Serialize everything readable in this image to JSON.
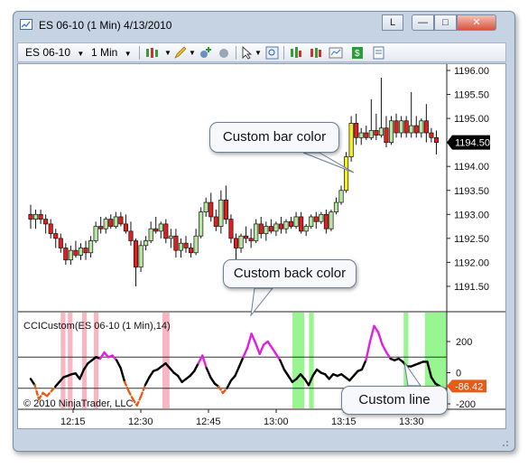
{
  "window": {
    "title": "ES 06-10 (1 Min)  4/13/2010",
    "buttons": {
      "link": "L",
      "minimize": "—",
      "maximize": "□",
      "close": "✕"
    }
  },
  "toolbar": {
    "instrument": "ES 06-10",
    "interval": "1 Min"
  },
  "price_panel": {
    "y_ticks": [
      "1196.00",
      "1195.50",
      "1195.00",
      "1194.50",
      "1194.00",
      "1193.50",
      "1193.00",
      "1192.50",
      "1192.00",
      "1191.50"
    ],
    "current_price": "1194.50"
  },
  "indicator_panel": {
    "label": "CCICustom(ES 06-10 (1 Min),14)",
    "y_ticks": [
      "200",
      "0",
      "-200"
    ],
    "current_value": "-86.42",
    "copyright": "© 2010 NinjaTrader, LLC"
  },
  "x_axis": {
    "ticks": [
      "12:15",
      "12:30",
      "12:45",
      "13:00",
      "13:15",
      "13:30"
    ]
  },
  "callouts": {
    "bar_color": "Custom bar color",
    "back_color": "Custom back color",
    "line": "Custom line"
  },
  "colors": {
    "bar_up": "#b8e6a0",
    "bar_down": "#e0201e",
    "bar_custom": "#f4f020",
    "back_pink": "#f7b6c2",
    "back_green": "#98f590",
    "cci_magenta": "#e020e0",
    "cci_black": "#000000",
    "cci_orange": "#e85a18",
    "price_marker": "#000000",
    "cci_marker": "#e85a18"
  },
  "chart_data": {
    "type": "candlestick",
    "price_range": [
      1191.3,
      1196.1
    ],
    "bars": [
      [
        1193.0,
        1193.2,
        1192.7,
        1192.9
      ],
      [
        1192.9,
        1193.1,
        1192.7,
        1193.0
      ],
      [
        1193.0,
        1193.1,
        1192.8,
        1192.9
      ],
      [
        1192.9,
        1193.0,
        1192.6,
        1192.8
      ],
      [
        1192.8,
        1192.9,
        1192.5,
        1192.6
      ],
      [
        1192.6,
        1192.7,
        1192.3,
        1192.5
      ],
      [
        1192.5,
        1192.6,
        1192.2,
        1192.3
      ],
      [
        1192.3,
        1192.4,
        1191.95,
        1192.05
      ],
      [
        1192.05,
        1192.35,
        1191.95,
        1192.25
      ],
      [
        1192.25,
        1192.45,
        1192.1,
        1192.15
      ],
      [
        1192.15,
        1192.4,
        1192.05,
        1192.3
      ],
      [
        1192.3,
        1192.45,
        1192.05,
        1192.2
      ],
      [
        1192.2,
        1192.55,
        1192.1,
        1192.45
      ],
      [
        1192.45,
        1192.85,
        1192.4,
        1192.75
      ],
      [
        1192.75,
        1192.95,
        1192.6,
        1192.7
      ],
      [
        1192.7,
        1192.95,
        1192.6,
        1192.9
      ],
      [
        1192.9,
        1193.0,
        1192.7,
        1192.75
      ],
      [
        1192.75,
        1193.05,
        1192.7,
        1192.95
      ],
      [
        1192.95,
        1193.05,
        1192.75,
        1192.8
      ],
      [
        1192.8,
        1193.0,
        1192.6,
        1192.65
      ],
      [
        1192.65,
        1192.85,
        1192.35,
        1192.45
      ],
      [
        1192.45,
        1192.5,
        1191.5,
        1191.9
      ],
      [
        1191.9,
        1192.45,
        1191.8,
        1192.35
      ],
      [
        1192.35,
        1192.55,
        1192.25,
        1192.45
      ],
      [
        1192.45,
        1192.85,
        1192.4,
        1192.7
      ],
      [
        1192.7,
        1192.95,
        1192.6,
        1192.65
      ],
      [
        1192.65,
        1192.85,
        1192.5,
        1192.8
      ],
      [
        1192.8,
        1192.9,
        1192.4,
        1192.5
      ],
      [
        1192.5,
        1192.7,
        1192.3,
        1192.55
      ],
      [
        1192.55,
        1192.7,
        1192.1,
        1192.25
      ],
      [
        1192.25,
        1192.5,
        1192.1,
        1192.4
      ],
      [
        1192.4,
        1192.55,
        1192.2,
        1192.3
      ],
      [
        1192.3,
        1192.4,
        1192.1,
        1192.2
      ],
      [
        1192.2,
        1192.7,
        1192.15,
        1192.55
      ],
      [
        1192.55,
        1193.15,
        1192.5,
        1193.05
      ],
      [
        1193.05,
        1193.35,
        1192.95,
        1193.25
      ],
      [
        1193.25,
        1193.45,
        1192.85,
        1192.95
      ],
      [
        1192.95,
        1193.1,
        1192.65,
        1192.75
      ],
      [
        1192.75,
        1193.5,
        1192.6,
        1193.3
      ],
      [
        1193.3,
        1193.6,
        1192.8,
        1192.9
      ],
      [
        1192.9,
        1193.0,
        1192.4,
        1192.5
      ],
      [
        1192.5,
        1192.6,
        1192.0,
        1192.3
      ],
      [
        1192.3,
        1192.6,
        1192.2,
        1192.55
      ],
      [
        1192.55,
        1192.75,
        1192.4,
        1192.5
      ],
      [
        1192.5,
        1192.7,
        1192.3,
        1192.45
      ],
      [
        1192.45,
        1192.9,
        1192.4,
        1192.8
      ],
      [
        1192.8,
        1192.95,
        1192.5,
        1192.6
      ],
      [
        1192.6,
        1192.85,
        1192.45,
        1192.75
      ],
      [
        1192.75,
        1192.9,
        1192.6,
        1192.65
      ],
      [
        1192.65,
        1192.85,
        1192.55,
        1192.8
      ],
      [
        1192.8,
        1192.95,
        1192.6,
        1192.7
      ],
      [
        1192.7,
        1192.9,
        1192.6,
        1192.85
      ],
      [
        1192.85,
        1192.95,
        1192.7,
        1192.75
      ],
      [
        1192.75,
        1193.05,
        1192.7,
        1192.95
      ],
      [
        1192.95,
        1193.05,
        1192.6,
        1192.65
      ],
      [
        1192.65,
        1192.8,
        1192.55,
        1192.75
      ],
      [
        1192.75,
        1193.0,
        1192.7,
        1192.95
      ],
      [
        1192.95,
        1193.05,
        1192.7,
        1192.85
      ],
      [
        1192.85,
        1193.05,
        1192.8,
        1193.0
      ],
      [
        1193.0,
        1193.1,
        1192.6,
        1192.7
      ],
      [
        1192.7,
        1193.1,
        1192.65,
        1193.05
      ],
      [
        1193.05,
        1193.35,
        1193.0,
        1193.25
      ],
      [
        1193.25,
        1193.6,
        1193.2,
        1193.5
      ],
      [
        1193.5,
        1194.3,
        1193.45,
        1194.2
      ],
      [
        1194.2,
        1195.05,
        1194.1,
        1194.9
      ],
      [
        1194.9,
        1195.1,
        1194.45,
        1194.6
      ],
      [
        1194.6,
        1194.8,
        1194.45,
        1194.7
      ],
      [
        1194.7,
        1194.85,
        1194.55,
        1194.6
      ],
      [
        1194.6,
        1195.4,
        1194.55,
        1194.75
      ],
      [
        1194.75,
        1195.1,
        1194.55,
        1194.65
      ],
      [
        1194.65,
        1195.85,
        1194.6,
        1194.8
      ],
      [
        1194.8,
        1195.05,
        1194.4,
        1194.5
      ],
      [
        1194.5,
        1195.05,
        1194.45,
        1194.95
      ],
      [
        1194.95,
        1195.1,
        1194.6,
        1194.7
      ],
      [
        1194.7,
        1195.05,
        1194.6,
        1194.95
      ],
      [
        1194.95,
        1195.05,
        1194.6,
        1194.7
      ],
      [
        1194.7,
        1195.55,
        1194.6,
        1194.85
      ],
      [
        1194.85,
        1195.05,
        1194.6,
        1194.7
      ],
      [
        1194.7,
        1195.0,
        1194.6,
        1194.95
      ],
      [
        1194.95,
        1195.3,
        1194.5,
        1194.7
      ],
      [
        1194.7,
        1194.8,
        1194.5,
        1194.6
      ],
      [
        1194.6,
        1194.75,
        1194.25,
        1194.5
      ]
    ],
    "custom_bars": [
      63,
      64
    ],
    "cci_range": [
      -230,
      250
    ],
    "cci": [
      -40,
      -80,
      -170,
      -130,
      -150,
      -120,
      -90,
      -60,
      -30,
      -20,
      -10,
      -5,
      -40,
      20,
      60,
      80,
      100,
      90,
      130,
      100,
      110,
      80,
      30,
      -60,
      -120,
      -170,
      -210,
      -150,
      -80,
      -30,
      10,
      20,
      40,
      60,
      30,
      0,
      -20,
      -60,
      -40,
      -20,
      10,
      60,
      110,
      30,
      -30,
      -70,
      -90,
      -130,
      -100,
      -50,
      -20,
      40,
      100,
      160,
      250,
      190,
      120,
      180,
      200,
      160,
      120,
      80,
      20,
      -20,
      -60,
      -40,
      -10,
      -40,
      -80,
      -20,
      20,
      0,
      -10,
      -40,
      -10,
      -20,
      -10,
      -30,
      -50,
      -20,
      10,
      20,
      80,
      200,
      300,
      260,
      180,
      130,
      90,
      80,
      90,
      70,
      40,
      40,
      50,
      60,
      70,
      70,
      -30,
      -70,
      -86
    ],
    "back_pink": [
      [
        15,
        17
      ],
      [
        18,
        20
      ],
      [
        24,
        26
      ],
      [
        29,
        31
      ],
      [
        58,
        61
      ]
    ],
    "back_green": [
      [
        113,
        118
      ],
      [
        120,
        122
      ],
      [
        160,
        162
      ],
      [
        169,
        178
      ]
    ]
  }
}
